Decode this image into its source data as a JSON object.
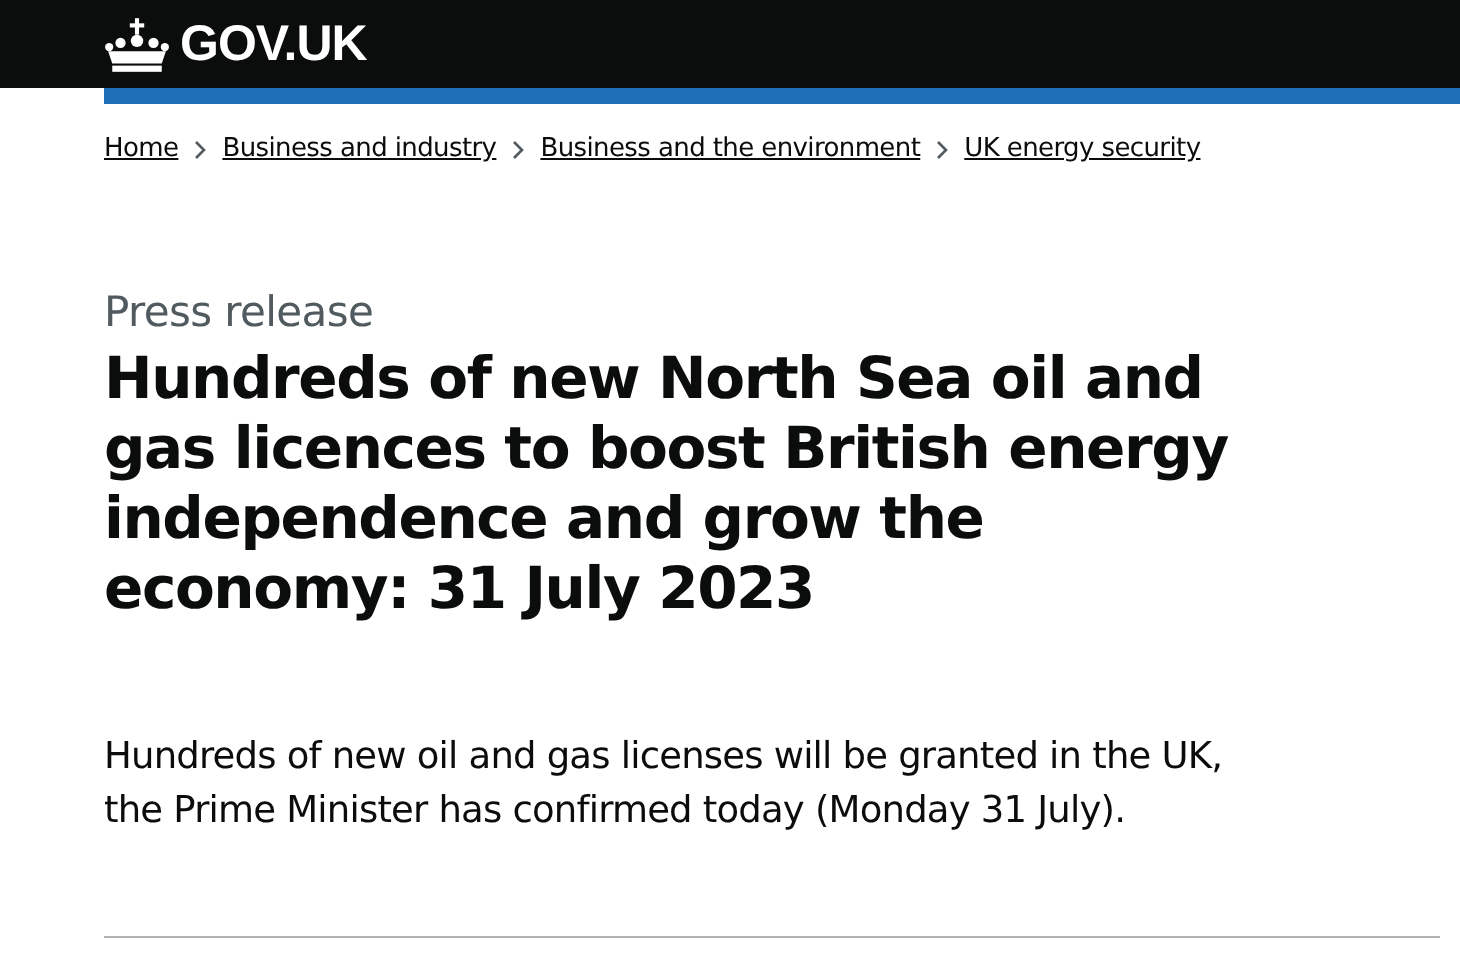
{
  "header": {
    "logo_text": "GOV.UK"
  },
  "breadcrumbs": [
    "Home",
    "Business and industry",
    "Business and the environment",
    "UK energy security"
  ],
  "caption": "Press release",
  "title": "Hundreds of new North Sea oil and gas licences to boost British energy independence and grow the economy: 31 July 2023",
  "lede": "Hundreds of new oil and gas licenses will be granted in the UK, the Prime Minister has confirmed today (Monday 31 July)."
}
